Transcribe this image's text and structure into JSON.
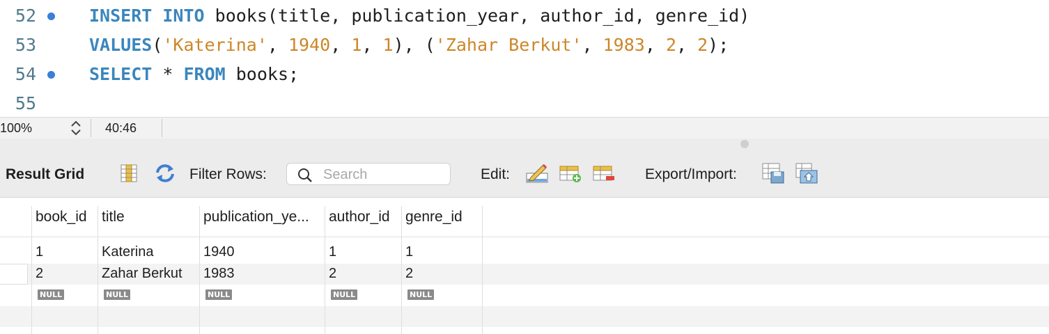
{
  "editor": {
    "lines": [
      {
        "num": "52",
        "dot": true
      },
      {
        "num": "53",
        "dot": false
      },
      {
        "num": "54",
        "dot": true
      },
      {
        "num": "55",
        "dot": false
      }
    ],
    "code": {
      "l52": {
        "kw1": "INSERT",
        "kw2": "INTO",
        "rest": "books(title, publication_year, author_id, genre_id)"
      },
      "l53": {
        "kw": "VALUES",
        "p1": "(",
        "s1": "'Katerina'",
        "c1": ", ",
        "n1": "1940",
        "c2": ", ",
        "n2": "1",
        "c3": ", ",
        "n3": "1",
        "p2": "), (",
        "s2": "'Zahar Berkut'",
        "c4": ", ",
        "n4": "1983",
        "c5": ", ",
        "n5": "2",
        "c6": ", ",
        "n6": "2",
        "p3": ");"
      },
      "l54": {
        "kw1": "SELECT",
        "star": " * ",
        "kw2": "FROM",
        "rest": " books;"
      }
    }
  },
  "status": {
    "zoom": "100%",
    "position": "40:46"
  },
  "toolbar": {
    "result_grid": "Result Grid",
    "filter_rows": "Filter Rows:",
    "search_placeholder": "Search",
    "edit": "Edit:",
    "export_import": "Export/Import:"
  },
  "grid": {
    "columns": [
      "book_id",
      "title",
      "publication_ye...",
      "author_id",
      "genre_id"
    ],
    "rows": [
      [
        "1",
        "Katerina",
        "1940",
        "1",
        "1"
      ],
      [
        "2",
        "Zahar Berkut",
        "1983",
        "2",
        "2"
      ]
    ],
    "null_label": "NULL"
  },
  "colors": {
    "keyword": "#3b86bd",
    "literal": "#cc8728",
    "line_number": "#52798c",
    "breakpoint": "#3a7fd8"
  }
}
